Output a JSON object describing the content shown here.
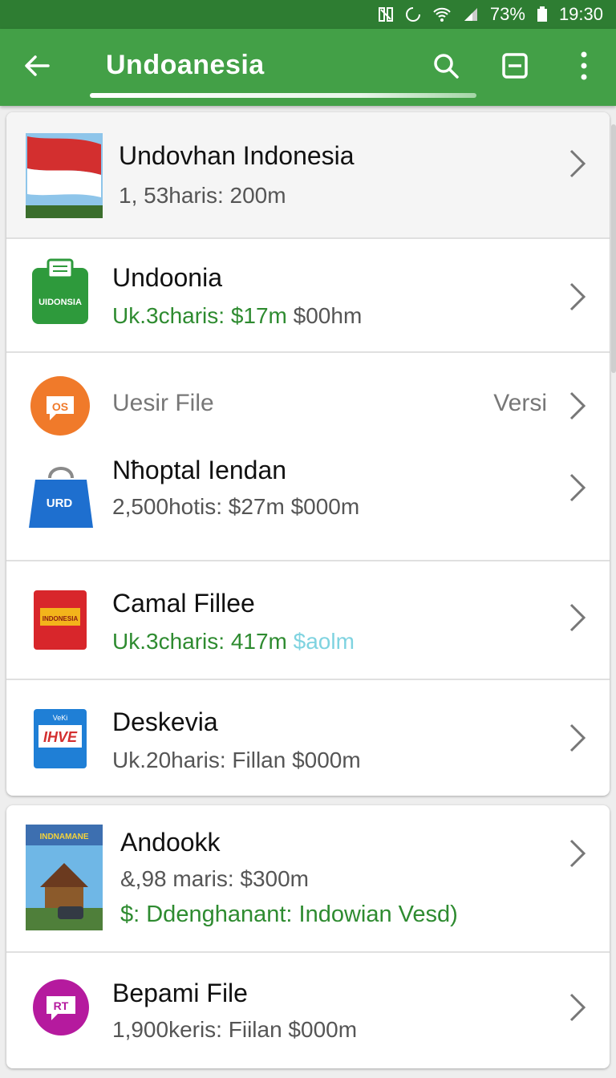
{
  "status_bar": {
    "battery": "73%",
    "time": "19:30"
  },
  "app_bar": {
    "title": "Undoanesia"
  },
  "list_card_1": [
    {
      "name": "Undovhan Indonesia",
      "meta": "1, 53haris:  200m",
      "icon": "indonesia-flag-thumbnail"
    },
    {
      "name": "Undoonia",
      "meta_green": "Uk.3charis:  $17m",
      "meta_gray": " $00hm",
      "icon": "udonsia-document-icon"
    },
    {
      "name": "Uesir File",
      "version": "Versi",
      "icon": "os-chat-bubble-icon"
    },
    {
      "name": "Nħoptal Iendan",
      "meta": "2,500hotis:  $27m  $000m",
      "icon": "urd-shopping-bag-icon"
    },
    {
      "name": "Camal Fillee",
      "meta_green": "Uk.3charis:  417m",
      "meta_cyan": " $aolm",
      "icon": "red-product-box-icon"
    },
    {
      "name": "Deskevia",
      "meta": "Uk.20haris:  Fillan  $000m",
      "icon": "blue-ihve-icon"
    }
  ],
  "list_card_2": [
    {
      "name": "Andookk",
      "meta": "&,98 maris:  $300m",
      "extra": "$: Ddenghanant: Indowian Vesd)",
      "icon": "indonesia-travel-thumbnail"
    },
    {
      "name": "Bepami File",
      "meta": "1,900keris:  Fiilan  $000m",
      "icon": "rt-chat-bubble-icon"
    }
  ],
  "thumb_text": {
    "udonsia": "UIDONSIA",
    "os": "OS",
    "urd": "URD",
    "red_box": "INDONESIA",
    "ihve": "IHVE",
    "ihve_small": "VeKi",
    "travel": "INDNAMANE",
    "rt": "RT"
  },
  "colors": {
    "status_bar": "#2e7d32",
    "app_bar": "#43a047",
    "accent_green": "#2e8b30"
  }
}
